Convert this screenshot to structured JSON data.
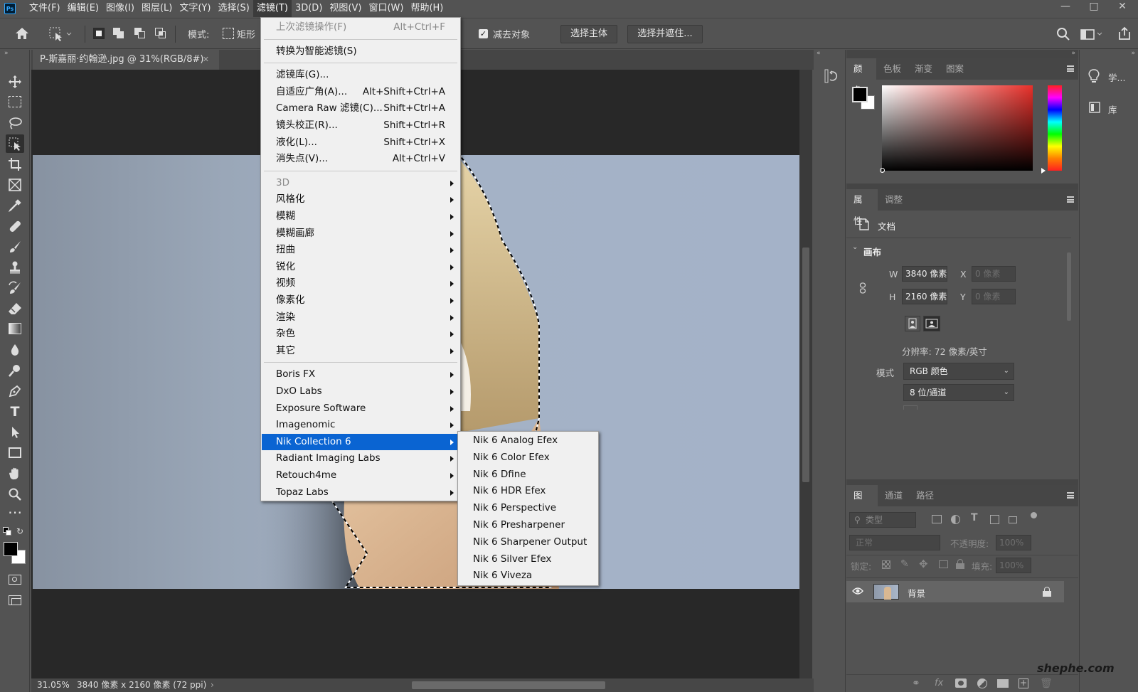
{
  "app": {
    "logo_text": "Ps"
  },
  "menubar": {
    "items": [
      "文件(F)",
      "编辑(E)",
      "图像(I)",
      "图层(L)",
      "文字(Y)",
      "选择(S)",
      "滤镜(T)",
      "3D(D)",
      "视图(V)",
      "窗口(W)",
      "帮助(H)"
    ],
    "active_index": 6
  },
  "options_bar": {
    "mode_label": "模式:",
    "mode_value": "矩形",
    "subtract_label": "减去对象",
    "subtract_checked": true,
    "select_subject": "选择主体",
    "select_and_mask": "选择并遮住..."
  },
  "document": {
    "tab_title": "P-斯嘉丽·约翰逊.jpg @ 31%(RGB/8#)",
    "zoom": "31.05%",
    "dimensions": "3840 像素 x 2160 像素 (72 ppi)"
  },
  "filter_menu": {
    "items": [
      {
        "label": "上次滤镜操作(F)",
        "shortcut": "Alt+Ctrl+F",
        "disabled": true
      },
      {
        "label": "转换为智能滤镜(S)"
      },
      {
        "label": "滤镜库(G)..."
      },
      {
        "label": "自适应广角(A)...",
        "shortcut": "Alt+Shift+Ctrl+A"
      },
      {
        "label": "Camera Raw 滤镜(C)...",
        "shortcut": "Shift+Ctrl+A"
      },
      {
        "label": "镜头校正(R)...",
        "shortcut": "Shift+Ctrl+R"
      },
      {
        "label": "液化(L)...",
        "shortcut": "Shift+Ctrl+X"
      },
      {
        "label": "消失点(V)...",
        "shortcut": "Alt+Ctrl+V"
      },
      {
        "label": "3D",
        "disabled": true,
        "submenu": true
      },
      {
        "label": "风格化",
        "submenu": true
      },
      {
        "label": "模糊",
        "submenu": true
      },
      {
        "label": "模糊画廊",
        "submenu": true
      },
      {
        "label": "扭曲",
        "submenu": true
      },
      {
        "label": "锐化",
        "submenu": true
      },
      {
        "label": "视频",
        "submenu": true
      },
      {
        "label": "像素化",
        "submenu": true
      },
      {
        "label": "渲染",
        "submenu": true
      },
      {
        "label": "杂色",
        "submenu": true
      },
      {
        "label": "其它",
        "submenu": true
      },
      {
        "label": "Boris FX",
        "submenu": true
      },
      {
        "label": "DxO Labs",
        "submenu": true
      },
      {
        "label": "Exposure Software",
        "submenu": true
      },
      {
        "label": "Imagenomic",
        "submenu": true
      },
      {
        "label": "Nik Collection 6",
        "submenu": true,
        "highlighted": true
      },
      {
        "label": "Radiant Imaging Labs",
        "submenu": true
      },
      {
        "label": "Retouch4me",
        "submenu": true
      },
      {
        "label": "Topaz Labs",
        "submenu": true
      }
    ]
  },
  "nik_submenu": {
    "items": [
      "Nik 6 Analog Efex",
      "Nik 6 Color Efex",
      "Nik 6 Dfine",
      "Nik 6 HDR Efex",
      "Nik 6 Perspective",
      "Nik 6 Presharpener",
      "Nik 6 Sharpener Output",
      "Nik 6 Silver Efex",
      "Nik 6 Viveza"
    ]
  },
  "color_panel": {
    "tabs": [
      "颜色",
      "色板",
      "渐变",
      "图案"
    ],
    "active_tab": 0,
    "foreground": "#000000",
    "background": "#ffffff",
    "hue_color": "#e8302a"
  },
  "properties_panel": {
    "tabs": [
      "属性",
      "调整"
    ],
    "doc_label": "文档",
    "canvas_label": "画布",
    "w_label": "W",
    "w_value": "3840 像素",
    "h_label": "H",
    "h_value": "2160 像素",
    "x_label": "X",
    "x_value": "0 像素",
    "y_label": "Y",
    "y_value": "0 像素",
    "resolution": "分辨率: 72 像素/英寸",
    "mode_label": "模式",
    "mode_value": "RGB 颜色",
    "bits_value": "8 位/通道"
  },
  "layers_panel": {
    "tabs": [
      "图层",
      "通道",
      "路径"
    ],
    "filter_kind": "类型",
    "blend_mode": "正常",
    "opacity_label": "不透明度:",
    "opacity_value": "100%",
    "lock_label": "锁定:",
    "fill_label": "填充:",
    "fill_value": "100%",
    "layer_name": "背景"
  },
  "right_dock": {
    "learn": "学...",
    "library": "库"
  },
  "watermark": "shephe.com"
}
